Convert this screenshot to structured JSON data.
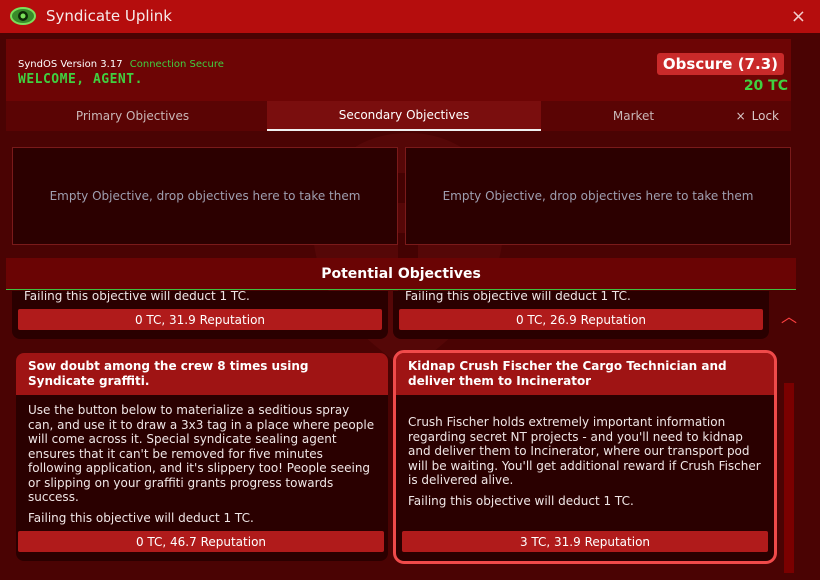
{
  "window": {
    "title": "Syndicate Uplink",
    "close_label": "×"
  },
  "header": {
    "version": "SyndOS Version 3.17",
    "connection": "Connection Secure",
    "welcome": "WELCOME, AGENT.",
    "reputation": "Obscure (7.3)",
    "telecrystals": "20 TC"
  },
  "tabs": [
    {
      "label": "Primary Objectives",
      "active": false
    },
    {
      "label": "Secondary Objectives",
      "active": true
    },
    {
      "label": "Market",
      "active": false
    }
  ],
  "lock": {
    "icon": "×",
    "label": "Lock"
  },
  "slots": [
    {
      "text": "Empty Objective, drop objectives here to take them"
    },
    {
      "text": "Empty Objective, drop objectives here to take them"
    }
  ],
  "potential": {
    "title": "Potential Objectives"
  },
  "cards_top": [
    {
      "deduct": "Failing this objective will deduct 1 TC.",
      "reward": "0 TC, 31.9 Reputation"
    },
    {
      "deduct": "Failing this objective will deduct 1 TC.",
      "reward": "0 TC, 26.9 Reputation"
    }
  ],
  "cards": [
    {
      "title": "Sow doubt among the crew 8 times using Syndicate graffiti.",
      "description": "Use the button below to materialize a seditious spray can, and use it to draw a 3x3 tag in a place where people will come across it. Special syndicate sealing agent ensures that it can't be removed for five minutes following application, and it's slippery too! People seeing or slipping on your graffiti grants progress towards success.",
      "deduct": "Failing this objective will deduct 1 TC.",
      "reward": "0 TC, 46.7 Reputation"
    },
    {
      "title": "Kidnap Crush Fischer the Cargo Technician and deliver them to Incinerator",
      "description": "Crush Fischer holds extremely important information regarding secret NT projects - and you'll need to kidnap and deliver them to Incinerator, where our transport pod will be waiting. You'll get additional reward if Crush Fischer is delivered alive.",
      "deduct": "Failing this objective will deduct 1 TC.",
      "reward": "3 TC, 31.9 Reputation"
    }
  ],
  "colors": {
    "accent": "#b50d0d",
    "success": "#40d040",
    "reward_bar": "#b01b1b",
    "selected_outline": "#f04a4a"
  }
}
